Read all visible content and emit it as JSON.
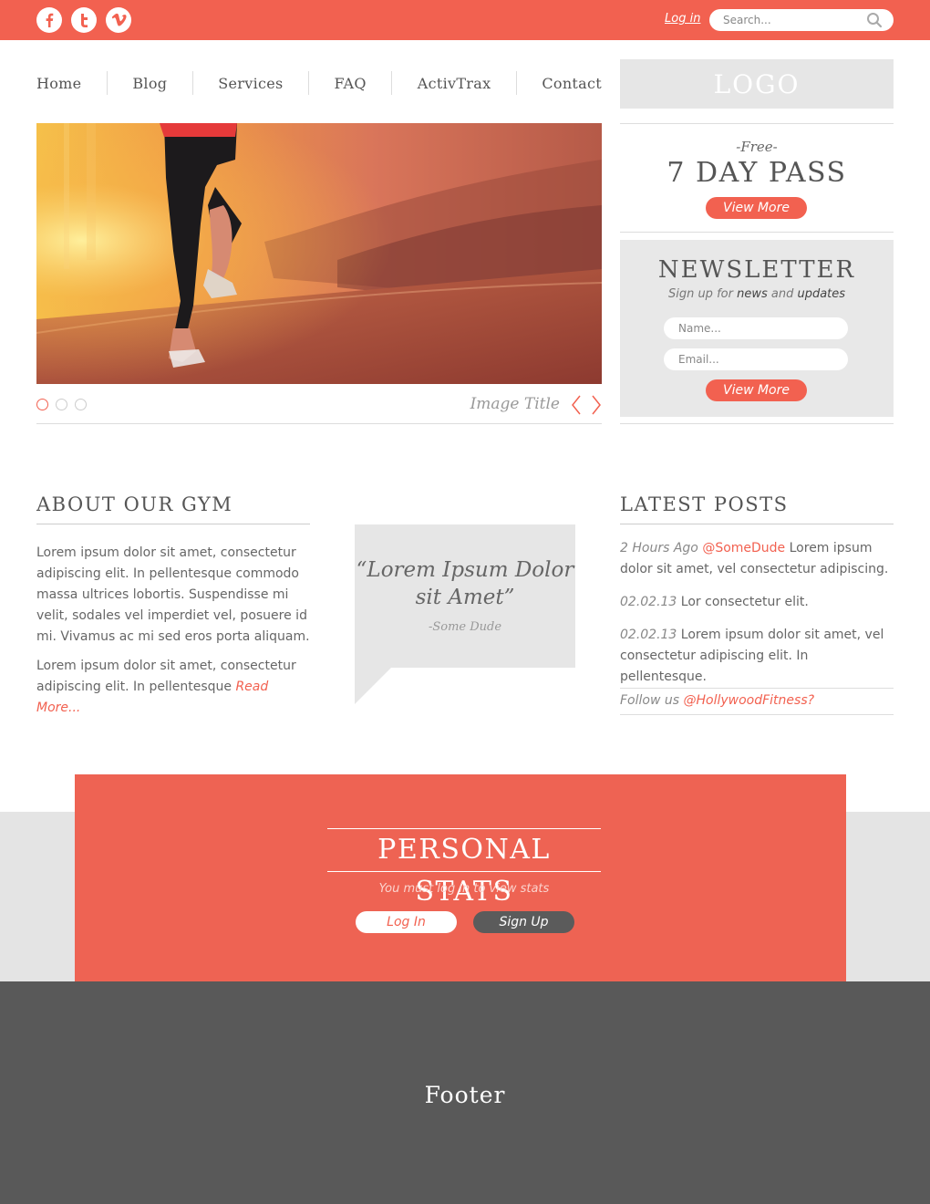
{
  "topbar": {
    "social": [
      {
        "name": "facebook-icon",
        "glyph": "f"
      },
      {
        "name": "twitter-icon",
        "glyph": "t"
      },
      {
        "name": "vimeo-icon",
        "glyph": "v"
      }
    ],
    "login_label": "Log in",
    "search_placeholder": "Search..."
  },
  "nav": {
    "items": [
      "Home",
      "Blog",
      "Services",
      "FAQ",
      "ActivTrax",
      "Contact"
    ]
  },
  "logo": {
    "text": "LOGO"
  },
  "hero": {
    "image_title": "Image Title",
    "slides_count": 3,
    "active_slide": 1
  },
  "pass": {
    "free_label": "-Free-",
    "title": "7 DAY PASS",
    "button_label": "View More"
  },
  "newsletter": {
    "title": "NEWSLETTER",
    "sub_prefix": "Sign up for ",
    "sub_news": "news",
    "sub_and": " and ",
    "sub_updates": "updates",
    "name_placeholder": "Name...",
    "email_placeholder": "Email...",
    "button_label": "View More"
  },
  "about": {
    "title": "ABOUT OUR GYM",
    "para1": "Lorem ipsum dolor sit amet, consectetur adipiscing elit. In pellentesque commodo massa ultrices lobortis. Suspendisse mi velit, sodales vel imperdiet vel, posuere id mi. Vivamus ac mi sed eros porta aliquam.",
    "para2": "Lorem ipsum dolor sit amet, consectetur adipiscing elit. In pellentesque ",
    "read_more": "Read More..."
  },
  "quote": {
    "text": "“Lorem Ipsum Dolor sit Amet”",
    "author": "-Some Dude"
  },
  "posts": {
    "title": "LATEST POSTS",
    "items": [
      {
        "date": "2 Hours Ago",
        "user": "@SomeDude",
        "text": " Lorem ipsum dolor sit amet, vel consectetur adipiscing."
      },
      {
        "date": "02.02.13",
        "user": "",
        "text": " Lor consectetur elit."
      },
      {
        "date": "02.02.13",
        "user": "",
        "text": " Lorem ipsum dolor sit amet, vel consectetur adipiscing elit. In pellentesque."
      }
    ],
    "follow_prefix": "Follow us ",
    "follow_handle": "@HollywoodFitness?"
  },
  "stats": {
    "title": "PERSONAL STATS",
    "subtitle": "You must log in to view stats",
    "login_label": "Log In",
    "signup_label": "Sign Up"
  },
  "footer": {
    "text": "Footer"
  },
  "colors": {
    "accent": "#f26150",
    "panel": "#e8e8e8",
    "footer": "#595959",
    "text": "#555555"
  }
}
